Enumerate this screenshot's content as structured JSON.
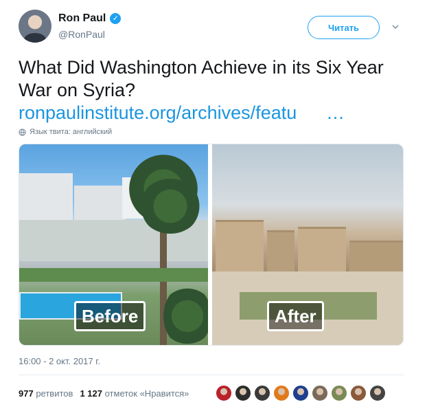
{
  "author": {
    "name": "Ron Paul",
    "handle": "@RonPaul",
    "verified_icon": "verified-badge-icon"
  },
  "follow_button_label": "Читать",
  "tweet": {
    "text": "What Did Washington Achieve in its Six Year War on Syria?",
    "link": "ronpaulinstitute.org/archives/featu",
    "ellipsis": "…",
    "language_note": "Язык твита: английский"
  },
  "media": {
    "before_label": "Before",
    "after_label": "After"
  },
  "timestamp": "16:00 - 2 окт. 2017 г.",
  "stats": {
    "retweets_count": "977",
    "retweets_label": "ретвитов",
    "likes_count": "1 127",
    "likes_label": "отметок «Нравится»"
  },
  "likers_avatar_colors": [
    "#b9222c",
    "#2d2d2d",
    "#3a3a3a",
    "#e07b1a",
    "#1f3f8f",
    "#7b6a5a",
    "#7a8a55",
    "#8a5a3a",
    "#444444"
  ],
  "colors": {
    "accent": "#1da1f2",
    "link": "#1b95e0",
    "text": "#14171a",
    "muted": "#657786"
  }
}
